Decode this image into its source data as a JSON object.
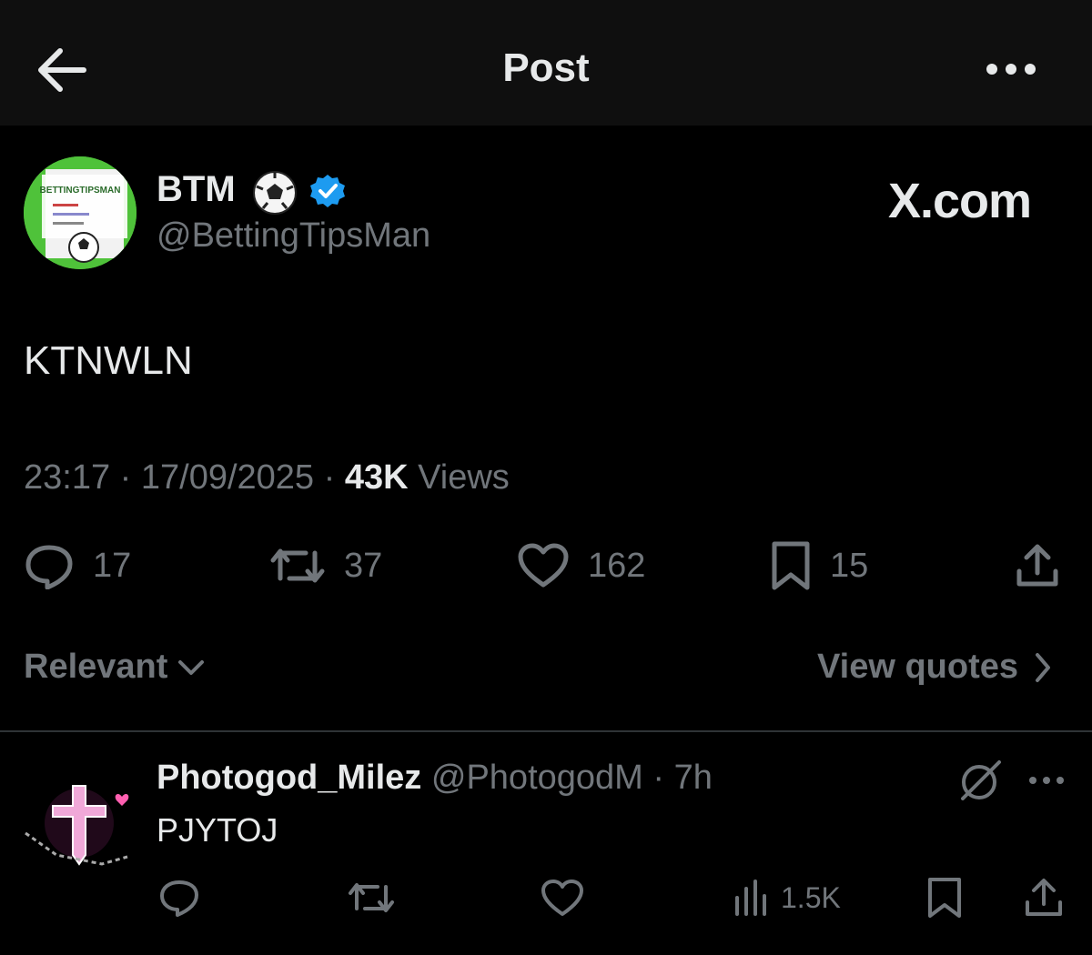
{
  "header": {
    "title": "Post",
    "back_icon": "arrow-left-icon",
    "more_icon": "more-horizontal-icon"
  },
  "post": {
    "author": {
      "display_name": "BTM",
      "name_emoji_icon": "soccer-ball-icon",
      "verified_icon": "verified-badge-icon",
      "handle": "@BettingTipsMan",
      "avatar_text": "BETTINGTIPSMAN"
    },
    "watermark": "X.com",
    "text": "KTNWLN",
    "meta": {
      "time": "23:17",
      "separator": "·",
      "date": "17/09/2025",
      "views_count": "43K",
      "views_label": "Views"
    },
    "actions": {
      "replies": "17",
      "reposts": "37",
      "likes": "162",
      "bookmarks": "15"
    }
  },
  "controls": {
    "sort_label": "Relevant",
    "view_quotes_label": "View quotes"
  },
  "reply": {
    "display_name": "Photogod_Milez",
    "handle": "@PhotogodM",
    "separator": "·",
    "time": "7h",
    "text": "PJYTOJ",
    "views": "1.5K"
  },
  "colors": {
    "background": "#000000",
    "topbar": "#0f0f0f",
    "text_primary": "#e7e9ea",
    "text_secondary": "#71767b",
    "verified": "#1d9bf0",
    "avatar_green": "#4fc23a",
    "divider": "#2f3336"
  }
}
